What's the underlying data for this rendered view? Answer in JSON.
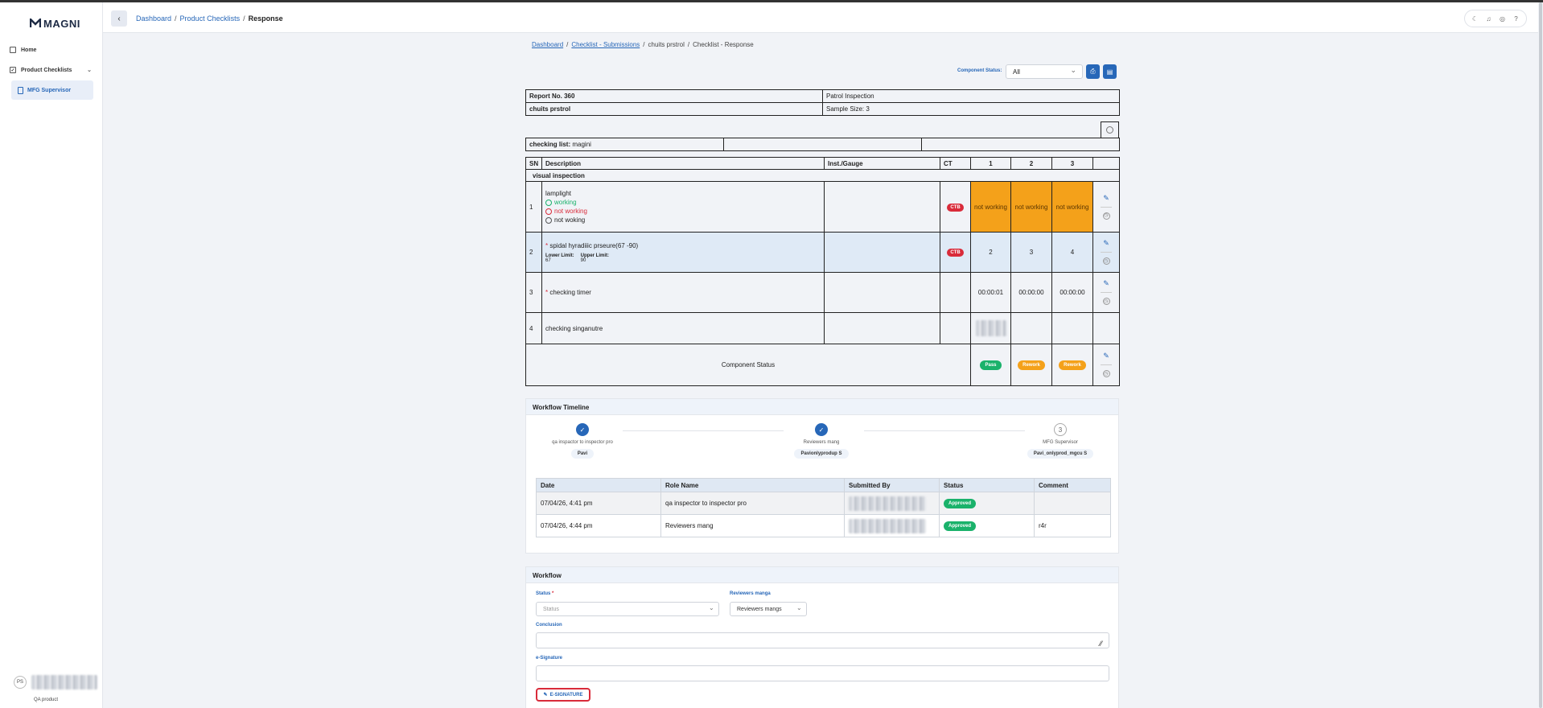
{
  "app": {
    "logo_text": "MAGNI"
  },
  "sidebar": {
    "items": [
      {
        "label": "Home"
      },
      {
        "label": "Product Checklists"
      }
    ],
    "active_item": {
      "label": "MFG Supervisor"
    },
    "user": {
      "initials": "PS",
      "role": "QA product"
    }
  },
  "topbar": {
    "breadcrumbs": [
      "Dashboard",
      "/",
      "Product Checklists",
      "/",
      "Response"
    ]
  },
  "page": {
    "breadcrumbs": [
      "Dashboard",
      "/",
      "Checklist - Submissions",
      "/",
      "chuits prstrol",
      "/",
      "Checklist - Response"
    ],
    "component_status_label": "Component Status:",
    "component_status_value": "All"
  },
  "report": {
    "report_no": "Report No. 360",
    "inspection_type": "Patrol Inspection",
    "name": "chuits prstrol",
    "sample_size": "Sample Size: 3",
    "checking_list_label": "checking list:",
    "checking_list_value": "magini"
  },
  "checklist": {
    "headers": {
      "sn": "SN",
      "description": "Description",
      "inst": "Inst./Gauge",
      "ct": "CT",
      "c1": "1",
      "c2": "2",
      "c3": "3"
    },
    "section": "visual inspection",
    "rows": [
      {
        "sn": "1",
        "title": "lamplight",
        "options": [
          "working",
          "not working",
          "not woking"
        ],
        "ct": "CTB",
        "v1": "not working",
        "v2": "not working",
        "v3": "not working"
      },
      {
        "sn": "2",
        "required": "*",
        "title": "spidal hyradiiic prseure(67 -90)",
        "lower_label": "Lower Limit:",
        "upper_label": "Upper Limit:",
        "lower": "67",
        "upper": "90",
        "ct": "CTB",
        "v1": "2",
        "v2": "3",
        "v3": "4"
      },
      {
        "sn": "3",
        "required": "*",
        "title": "checking timer",
        "v1": "00:00:01",
        "v2": "00:00:00",
        "v3": "00:00:00"
      },
      {
        "sn": "4",
        "title": "checking singanutre"
      }
    ],
    "component_status_label": "Component Status",
    "statuses": [
      "Pass",
      "Rework",
      "Rework"
    ]
  },
  "timeline": {
    "title": "Workflow Timeline",
    "steps": [
      {
        "role": "qa inspactor to inspector pro",
        "who": "Pavi",
        "state": "done"
      },
      {
        "role": "Reviewers mang",
        "who": "Pavionlyprodup S",
        "state": "done"
      },
      {
        "number": "3",
        "role": "MFG Supervisor",
        "who": "Pavi_onlyprod_mgcu S",
        "state": "pending"
      }
    ],
    "table_headers": [
      "Date",
      "Role Name",
      "Submitted By",
      "Status",
      "Comment"
    ],
    "table_rows": [
      {
        "date": "07/04/26, 4:41 pm",
        "role": "qa inspector to inspector pro",
        "status": "Approved",
        "comment": ""
      },
      {
        "date": "07/04/26, 4:44 pm",
        "role": "Reviewers mang",
        "status": "Approved",
        "comment": "r4r"
      }
    ]
  },
  "workflow": {
    "title": "Workflow",
    "status_label": "Status",
    "status_required": "*",
    "status_placeholder": "Status",
    "reviewers_label": "Reviewers manga",
    "reviewers_value": "Reviewers mangs",
    "conclusion_label": "Conclusion",
    "esignature_label": "e-Signature",
    "esignature_button": "E-SIGNATURE"
  },
  "colors": {
    "accent": "#2767b8",
    "ctb": "#d92b3a",
    "fail": "#f4a11a",
    "pass": "#1ab26b"
  },
  "icons": [
    "back-arrow-icon",
    "moon-icon",
    "bell-icon",
    "settings-icon",
    "help-icon",
    "print-icon",
    "document-icon",
    "history-icon",
    "edit-icon",
    "check-icon",
    "pen-icon",
    "home-icon",
    "checklist-icon",
    "file-icon"
  ]
}
